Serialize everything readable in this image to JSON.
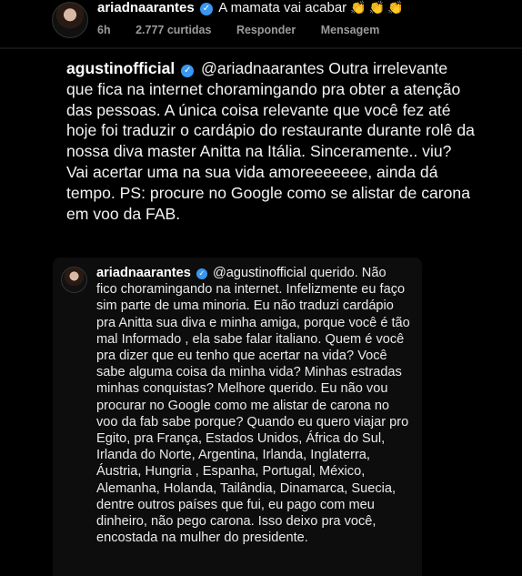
{
  "comment1": {
    "username": "ariadnaarantes",
    "text": "A mamata vai acabar",
    "emoji": "👏👏👏",
    "time": "6h",
    "likes": "2.777 curtidas",
    "reply_label": "Responder",
    "message_label": "Mensagem"
  },
  "comment2": {
    "username": "agustinofficial",
    "mention": "@ariadnaarantes",
    "text": "Outra irrelevante que fica na internet choramingando pra obter a atenção das pessoas. A única coisa relevante que você fez até hoje foi traduzir o cardápio do restaurante durante rolê da nossa diva master Anitta na Itália. Sinceramente.. viu? Vai acertar uma na sua vida amoreeeeeee, ainda dá tempo. PS: procure no Google como se alistar de carona em voo da FAB."
  },
  "reply": {
    "username": "ariadnaarantes",
    "mention": "@agustinofficial",
    "text": "querido. Não fico choramingando na internet. Infelizmente eu faço sim parte de uma minoria. Eu não traduzi cardápio pra Anitta sua diva e minha amiga, porque você é tão mal Informado , ela sabe falar italiano. Quem é você pra dizer que eu tenho que acertar na vida? Você sabe alguma coisa da minha vida? Minhas estradas minhas conquistas? Melhore querido. Eu não vou procurar no Google como me alistar de carona no voo da fab sabe porque? Quando eu quero viajar pro Egito, pra França, Estados Unidos, África do Sul, Irlanda do Norte, Argentina, Irlanda, Inglaterra, Áustria, Hungria , Espanha, Portugal, México, Alemanha, Holanda, Tailândia, Dinamarca, Suecia, dentre outros países que fui, eu pago com meu dinheiro, não pego carona. Isso deixo pra você, encostada na mulher do presidente."
  },
  "colors": {
    "background": "#000000",
    "verified": "#3897f0",
    "meta": "#9b9b9b"
  }
}
